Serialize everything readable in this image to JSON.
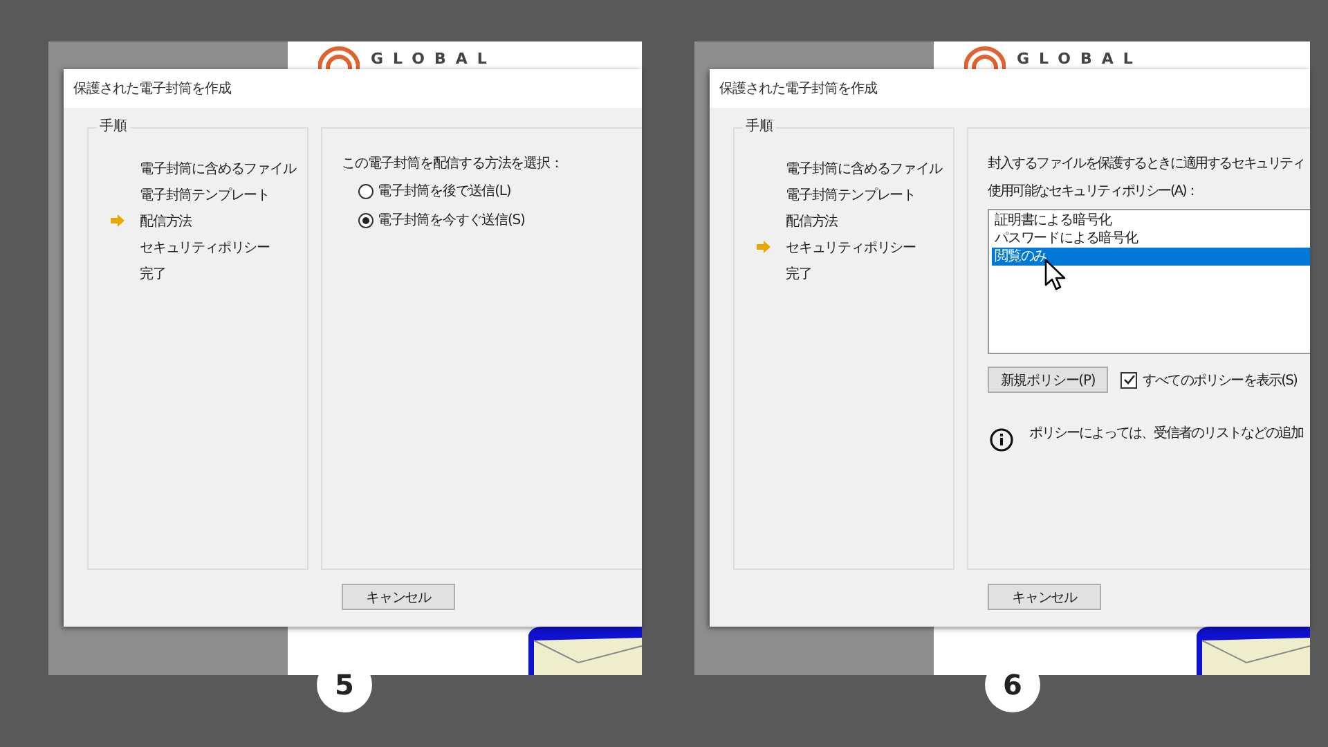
{
  "panels": [
    {
      "number": "5",
      "document": {
        "logo_text": "GLOBAL"
      },
      "dialog": {
        "title": "保護された電子封筒を作成",
        "steps_label": "手順",
        "steps": [
          {
            "label": "電子封筒に含めるファイル",
            "current": false
          },
          {
            "label": "電子封筒テンプレート",
            "current": false
          },
          {
            "label": "配信方法",
            "current": true
          },
          {
            "label": "セキュリティポリシー",
            "current": false
          },
          {
            "label": "完了",
            "current": false
          }
        ],
        "content": {
          "kind": "delivery",
          "prompt": "この電子封筒を配信する方法を選択：",
          "options": [
            {
              "label": "電子封筒を後で送信(L)",
              "selected": false
            },
            {
              "label": "電子封筒を今すぐ送信(S)",
              "selected": true
            }
          ]
        },
        "cancel_button": "キャンセル"
      }
    },
    {
      "number": "6",
      "document": {
        "logo_text": "GLOBAL"
      },
      "dialog": {
        "title": "保護された電子封筒を作成",
        "steps_label": "手順",
        "steps": [
          {
            "label": "電子封筒に含めるファイル",
            "current": false
          },
          {
            "label": "電子封筒テンプレート",
            "current": false
          },
          {
            "label": "配信方法",
            "current": false
          },
          {
            "label": "セキュリティポリシー",
            "current": true
          },
          {
            "label": "完了",
            "current": false
          }
        ],
        "content": {
          "kind": "security",
          "intro": "封入するファイルを保護するときに適用するセキュリティ",
          "list_label": "使用可能なセキュリティポリシー(A)：",
          "policies": [
            {
              "label": "証明書による暗号化",
              "selected": false
            },
            {
              "label": "パスワードによる暗号化",
              "selected": false
            },
            {
              "label": "閲覧のみ",
              "selected": true
            }
          ],
          "new_policy_button": "新規ポリシー(P)",
          "show_all": {
            "label": "すべてのポリシーを表示(S)",
            "checked": true
          },
          "info": "ポリシーによっては、受信者のリストなどの追加"
        },
        "cancel_button": "キャンセル"
      }
    }
  ]
}
